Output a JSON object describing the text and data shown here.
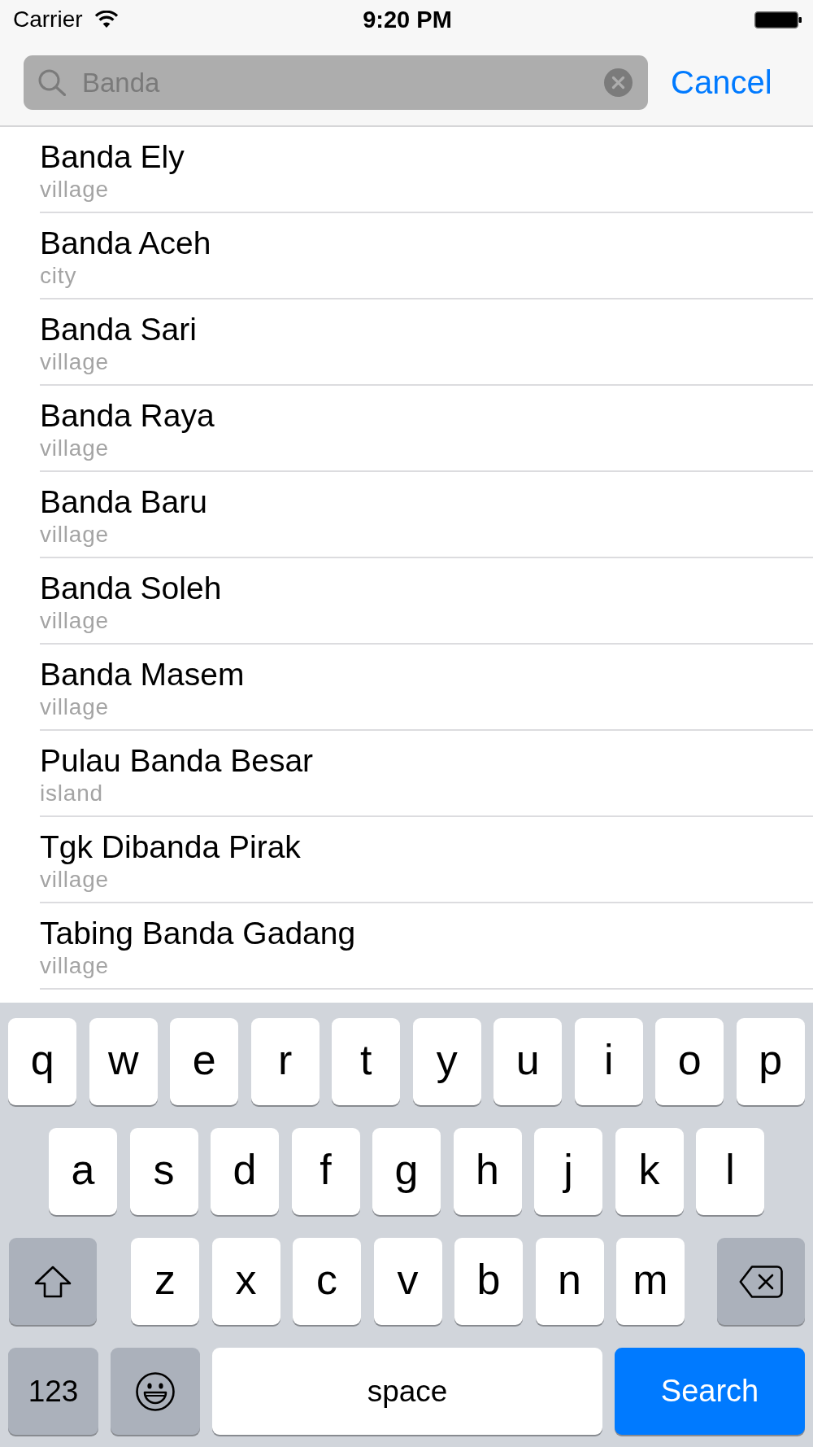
{
  "status_bar": {
    "carrier": "Carrier",
    "time": "9:20 PM"
  },
  "search": {
    "value": "Banda",
    "cancel": "Cancel"
  },
  "results": [
    {
      "name": "Banda Ely",
      "type": "village"
    },
    {
      "name": "Banda Aceh",
      "type": "city"
    },
    {
      "name": "Banda Sari",
      "type": "village"
    },
    {
      "name": "Banda Raya",
      "type": "village"
    },
    {
      "name": "Banda Baru",
      "type": "village"
    },
    {
      "name": "Banda Soleh",
      "type": "village"
    },
    {
      "name": "Banda Masem",
      "type": "village"
    },
    {
      "name": "Pulau Banda Besar",
      "type": "island"
    },
    {
      "name": "Tgk Dibanda Pirak",
      "type": "village"
    },
    {
      "name": "Tabing Banda Gadang",
      "type": "village"
    }
  ],
  "keyboard": {
    "rows": [
      {
        "keys": [
          {
            "kind": "letter",
            "label": "q"
          },
          {
            "kind": "letter",
            "label": "w"
          },
          {
            "kind": "letter",
            "label": "e"
          },
          {
            "kind": "letter",
            "label": "r"
          },
          {
            "kind": "letter",
            "label": "t"
          },
          {
            "kind": "letter",
            "label": "y"
          },
          {
            "kind": "letter",
            "label": "u"
          },
          {
            "kind": "letter",
            "label": "i"
          },
          {
            "kind": "letter",
            "label": "o"
          },
          {
            "kind": "letter",
            "label": "p"
          }
        ]
      },
      {
        "keys": [
          {
            "kind": "letter",
            "label": "a"
          },
          {
            "kind": "letter",
            "label": "s"
          },
          {
            "kind": "letter",
            "label": "d"
          },
          {
            "kind": "letter",
            "label": "f"
          },
          {
            "kind": "letter",
            "label": "g"
          },
          {
            "kind": "letter",
            "label": "h"
          },
          {
            "kind": "letter",
            "label": "j"
          },
          {
            "kind": "letter",
            "label": "k"
          },
          {
            "kind": "letter",
            "label": "l"
          }
        ]
      },
      {
        "keys": [
          {
            "kind": "shift"
          },
          {
            "kind": "letter",
            "label": "z"
          },
          {
            "kind": "letter",
            "label": "x"
          },
          {
            "kind": "letter",
            "label": "c"
          },
          {
            "kind": "letter",
            "label": "v"
          },
          {
            "kind": "letter",
            "label": "b"
          },
          {
            "kind": "letter",
            "label": "n"
          },
          {
            "kind": "letter",
            "label": "m"
          },
          {
            "kind": "delete"
          }
        ]
      },
      {
        "keys": [
          {
            "kind": "numbers",
            "label": "123"
          },
          {
            "kind": "emoji"
          },
          {
            "kind": "space",
            "label": "space"
          },
          {
            "kind": "action",
            "label": "Search"
          }
        ]
      }
    ]
  }
}
